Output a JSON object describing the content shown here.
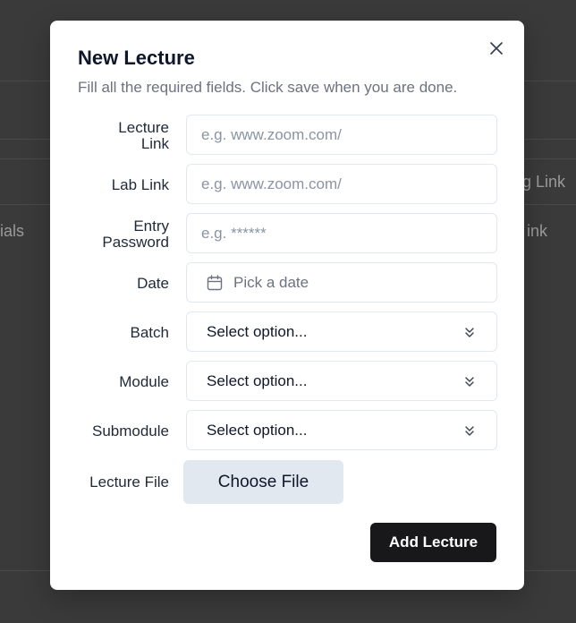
{
  "background": {
    "partial_texts": [
      "ials",
      "g Link",
      "ink"
    ]
  },
  "modal": {
    "title": "New Lecture",
    "description": "Fill all the required fields. Click save when you are done.",
    "close_icon": "close-icon"
  },
  "fields": {
    "lecture_link": {
      "label_line1": "Lecture",
      "label_line2": "Link",
      "placeholder": "e.g. www.zoom.com/"
    },
    "lab_link": {
      "label": "Lab Link",
      "placeholder": "e.g. www.zoom.com/"
    },
    "entry_password": {
      "label_line1": "Entry",
      "label_line2": "Password",
      "placeholder": "e.g. ******"
    },
    "date": {
      "label": "Date",
      "placeholder": "Pick a date",
      "icon": "calendar-icon"
    },
    "batch": {
      "label": "Batch",
      "value": "Select option...",
      "icon": "chevrons-down-icon"
    },
    "module": {
      "label": "Module",
      "value": "Select option...",
      "icon": "chevrons-down-icon"
    },
    "submodule": {
      "label": "Submodule",
      "value": "Select option...",
      "icon": "chevrons-down-icon"
    },
    "lecture_file": {
      "label": "Lecture File",
      "button_label": "Choose File"
    }
  },
  "actions": {
    "submit_label": "Add Lecture"
  },
  "colors": {
    "backdrop": "#3a3a3a",
    "modal_bg": "#ffffff",
    "input_border": "#e2e8f0",
    "placeholder": "#8a94a3",
    "primary_button": "#18181b",
    "file_button": "#e2e8f0"
  }
}
